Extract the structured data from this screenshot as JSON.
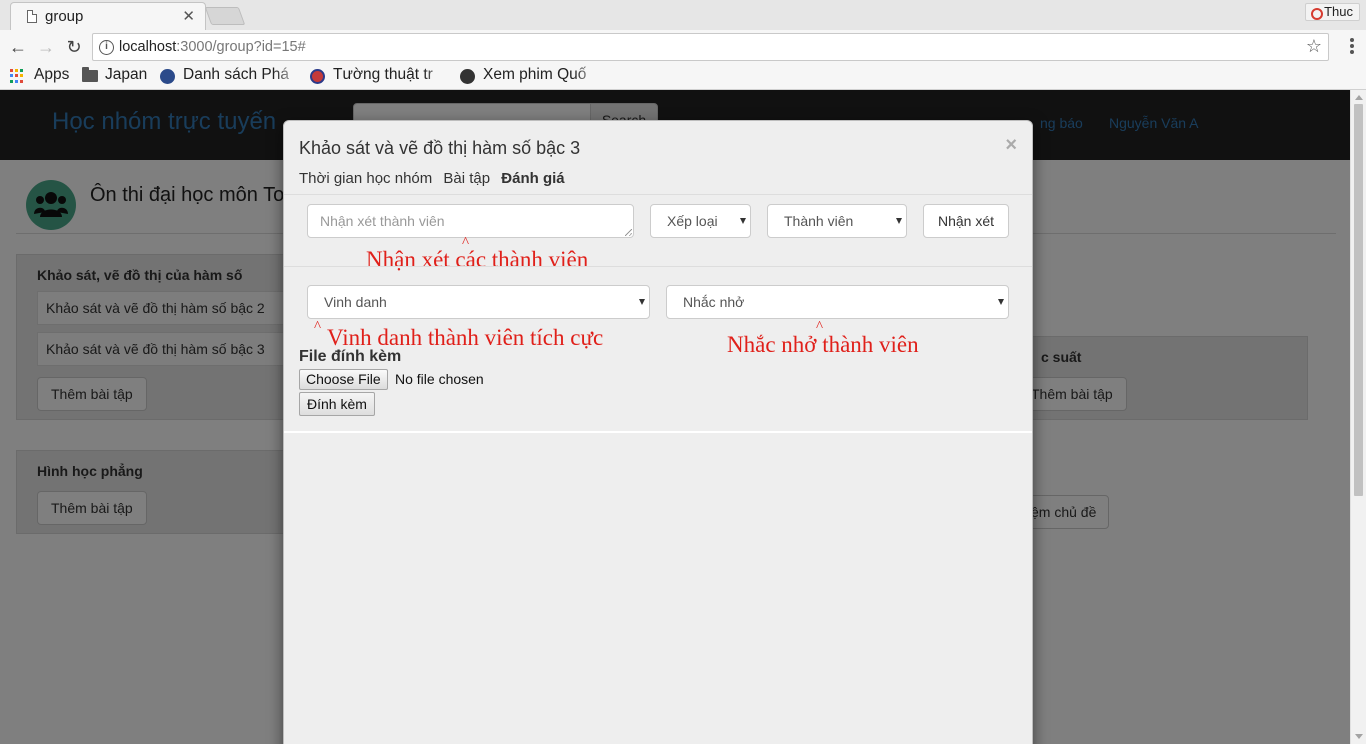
{
  "browser": {
    "tab_title": "group",
    "profile": "Thuc",
    "url_host": "localhost",
    "url_rest": ":3000/group?id=15#",
    "bookmarks": [
      "Apps",
      "Japan",
      "Danh sách Phá",
      "Tường thuật tr",
      "Xem phim Quố"
    ]
  },
  "site": {
    "brand": "Học nhóm trực tuyến",
    "search_placeholder": "Search",
    "search_button": "Search",
    "nav_notifications": "ng báo",
    "nav_user": "Nguyễn Văn A"
  },
  "group": {
    "title": "Ôn thi đại học môn To",
    "panels": [
      {
        "title": "Khảo sát, vẽ đồ thị của hàm số",
        "items": [
          "Khảo sát và vẽ đồ thị hàm số bậc 2",
          "Khảo sát và vẽ đồ thị hàm số bậc 3"
        ],
        "add_button": "Thêm bài tập"
      },
      {
        "title": "c suất",
        "add_button": "Thêm bài tập"
      },
      {
        "title": "Hình học phẳng",
        "add_button": "Thêm bài tập"
      }
    ],
    "add_topic_button": "ệm chủ đề"
  },
  "modal": {
    "title": "Khảo sát và vẽ đồ thị hàm số bậc 3",
    "close": "×",
    "tabs": [
      "Thời gian học nhóm",
      "Bài tập",
      "Đánh giá"
    ],
    "active_tab": "Đánh giá",
    "comment_placeholder": "Nhận xét thành viên",
    "rating_select": "Xếp loại",
    "member_select": "Thành viên",
    "comment_button": "Nhận xét",
    "honor_select": "Vinh danh",
    "remind_select": "Nhắc nhở",
    "file_label": "File đính kèm",
    "choose_file": "Choose File",
    "no_file": "No file chosen",
    "attach_button": "Đính kèm"
  },
  "annotations": {
    "comment_members": "Nhận xét các thành viên",
    "honor_members": "Vinh danh thành viên tích cực",
    "remind_members": "Nhắc nhở thành viên",
    "caret": "^"
  },
  "colors": {
    "annotation": "#e0201a",
    "brand": "#337ab7",
    "navbar": "#222222"
  }
}
